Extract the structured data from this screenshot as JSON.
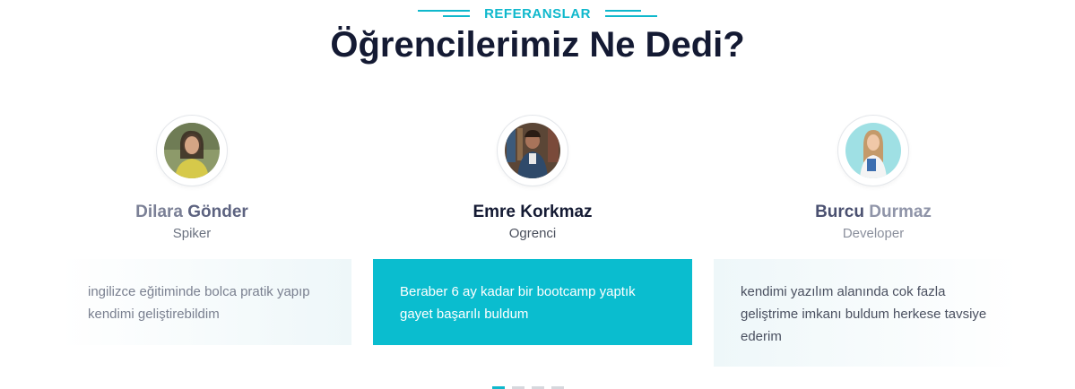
{
  "header": {
    "eyebrow": "REFERANSLAR",
    "title": "Öğrencilerimiz Ne Dedi?"
  },
  "testimonials": [
    {
      "name_first": "Dilara",
      "name_last": "Gönder",
      "role": "Spiker",
      "quote": "ingilizce eğitiminde bolca pratik yapıp kendimi geliştirebildim"
    },
    {
      "name_first": "Emre",
      "name_last": "Korkmaz",
      "role": "Ogrenci",
      "quote": "Beraber 6 ay kadar bir bootcamp yaptık gayet başarılı buldum"
    },
    {
      "name_first": "Burcu",
      "name_last": "Durmaz",
      "role": "Developer",
      "quote": "kendimi yazılım alanında cok fazla geliştrime imkanı buldum herkese tavsiye ederim"
    }
  ],
  "carousel": {
    "pages": 4,
    "active_index": 0
  },
  "colors": {
    "accent": "#0fb8cc",
    "heading": "#141a33",
    "active_card": "#0abdcf"
  }
}
